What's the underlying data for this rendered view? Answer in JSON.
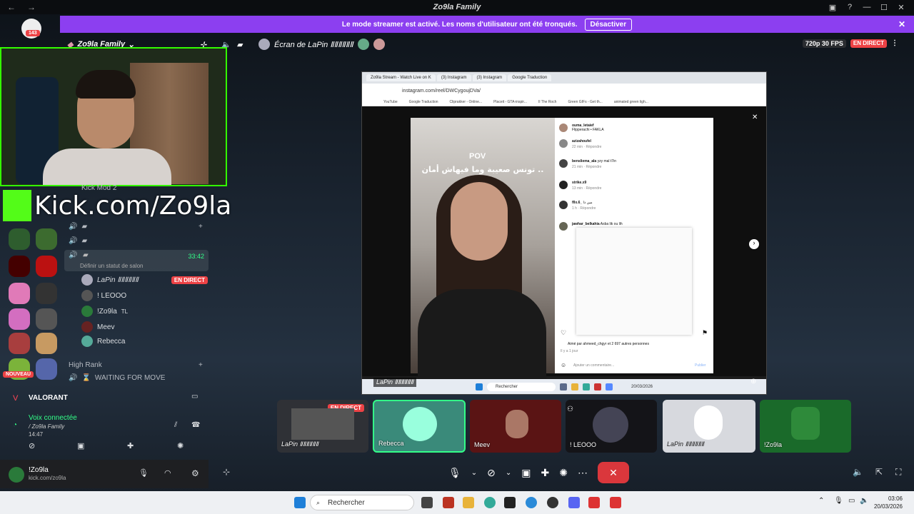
{
  "titlebar": {
    "title": "Zo9la Family"
  },
  "banner": {
    "text": "Le mode streamer est activé. Les noms d'utilisateur ont été tronqués.",
    "button": "Désactiver"
  },
  "server": {
    "name": "Zo9la Family",
    "badge": "143",
    "new_label": "NOUVEAU"
  },
  "call": {
    "screen_label": "Écran de LaPin ⅡⅡⅡⅡⅡⅡ",
    "quality": "720p 30 FPS",
    "live": "EN DIRECT"
  },
  "overlay": {
    "kick_text": "Kick.com/Zo9la"
  },
  "channels": {
    "kick_mod": "Kick Mod 2",
    "timer": "33:42",
    "status_hint": "Définir un statut de salon",
    "users": [
      {
        "name": "LaPin ⅡⅡⅡⅡⅡⅡ",
        "live": "EN DIRECT"
      },
      {
        "name": "! LEOOO"
      },
      {
        "name": "!Zo9la",
        "tag": "TL"
      },
      {
        "name": "Meev"
      },
      {
        "name": "Rebecca"
      }
    ],
    "category": "High Rank",
    "waiting": "WAITING FOR MOVE"
  },
  "voice": {
    "game": "VALORANT",
    "status": "Voix connectée",
    "channel": "/ Zo9la Family",
    "time": "14:47"
  },
  "user": {
    "name": "!Zo9la",
    "sub": "kick.com/zo9la"
  },
  "screenshare": {
    "tabs": [
      "Zo9la Stream - Watch Live on K",
      "(3) Instagram",
      "(3) Instagram",
      "Google Traduction"
    ],
    "url": "instagram.com/reel/DWCygoujDVa/",
    "bookmarks": [
      "YouTube",
      "Google Traduction",
      "Cliprakker - Online...",
      "Placeit - GTA-inspir...",
      "Il The Roch",
      "Green GIFs - Get th...",
      "animated green ligh..."
    ],
    "video_pov": "POV",
    "video_text": "تونس صعيبة وما فيهاش أمان ..",
    "post_author": "ouma_letaief",
    "post_sub": "Flipperachi • FAKLA",
    "comments": [
      {
        "name": "azizahoufel",
        "text": "",
        "time": "22 min",
        "reply": "Répondre"
      },
      {
        "name": "bensliema_ala",
        "text": "yzy mal t7in",
        "time": "21 min",
        "reply": "Répondre"
      },
      {
        "name": "strike.x9",
        "text": "",
        "time": "13 min",
        "reply": "Répondre"
      },
      {
        "name": "fllx.6_",
        "text": "مين ذا",
        "time": "1 h",
        "reply": "Répondre"
      },
      {
        "name": "jawhar_belkahia",
        "text": "Asba lik ou lih",
        "time": "",
        "reply": ""
      }
    ],
    "likes_text": "Aimé par ahmeed_chgyr et 2 697 autres personnes",
    "likes_time": "Il y a 1 jour",
    "comment_placeholder": "Ajouter un commentaire...",
    "publish": "Publier",
    "taskbar_search": "Rechercher",
    "date": "20/03/2026"
  },
  "tiles": [
    {
      "name": "LaPin ⅡⅡⅡⅡⅡⅡ",
      "live": "EN DIRECT",
      "bg": "#2f3136"
    },
    {
      "name": "Rebecca",
      "bg": "#3a8a7a"
    },
    {
      "name": "Meev",
      "bg": "#5a1414"
    },
    {
      "name": "! LEOOO",
      "bg": "#141418"
    },
    {
      "name": "LaPin ⅡⅡⅡⅡⅡⅡ",
      "bg": "#d7d9de"
    },
    {
      "name": "!Zo9la",
      "bg": "#1a6a2a"
    }
  ],
  "taskbar": {
    "search": "Rechercher",
    "time": "03:06",
    "date": "20/03/2026"
  },
  "colors": {
    "accent": "#8c3ff0",
    "live": "#ed4245",
    "kick": "#53fc18",
    "hangup": "#da373c"
  }
}
